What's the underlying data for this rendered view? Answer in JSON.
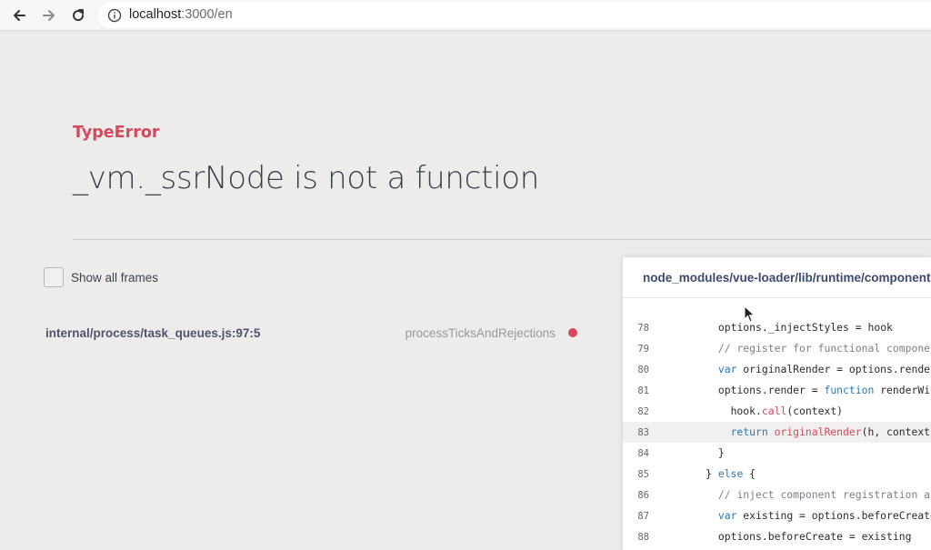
{
  "browser": {
    "back_icon": "arrow-left-icon",
    "forward_icon": "arrow-right-icon",
    "reload_icon": "reload-icon",
    "info_icon": "info-circle-icon",
    "url_host": "localhost",
    "url_rest": ":3000/en"
  },
  "error": {
    "type": "TypeError",
    "message": "_vm._ssrNode is not a function",
    "type_color": "#d5495f"
  },
  "frames": {
    "show_all_label": "Show all frames",
    "show_all_checked": false,
    "items": [
      {
        "file": "internal/process/task_queues.js:97:5",
        "function": "processTicksAndRejections",
        "status_color": "#d5495f"
      }
    ]
  },
  "source": {
    "path": "node_modules/vue-loader/lib/runtime/componentNo",
    "highlighted_line": "83",
    "lines": [
      {
        "num": "78",
        "indent": "        ",
        "a": "options.",
        "b": "_injectStyles = hook"
      },
      {
        "num": "79",
        "indent": "        ",
        "comment": "// register for functional component in"
      },
      {
        "num": "80",
        "indent": "        ",
        "kw": "var",
        "rest": " originalRender = options.render"
      },
      {
        "num": "81",
        "indent": "        ",
        "pre": "options.render = ",
        "kw": "function",
        "rest": " renderWithSty"
      },
      {
        "num": "82",
        "indent": "          ",
        "pre": "hook.",
        "fnname": "call",
        "rest": "(context)"
      },
      {
        "num": "83",
        "indent": "          ",
        "kw": "return",
        "fnname": " originalRender",
        "rest": "(h, context)"
      },
      {
        "num": "84",
        "indent": "        ",
        "pre": "}"
      },
      {
        "num": "85",
        "indent": "      ",
        "pre": "} ",
        "kw": "else",
        "rest": " {"
      },
      {
        "num": "86",
        "indent": "        ",
        "comment": "// inject component registration as bef"
      },
      {
        "num": "87",
        "indent": "        ",
        "kw": "var",
        "rest": " existing = options.beforeCreate"
      },
      {
        "num": "88",
        "indent": "        ",
        "pre": "options.beforeCreate = existing"
      }
    ]
  }
}
